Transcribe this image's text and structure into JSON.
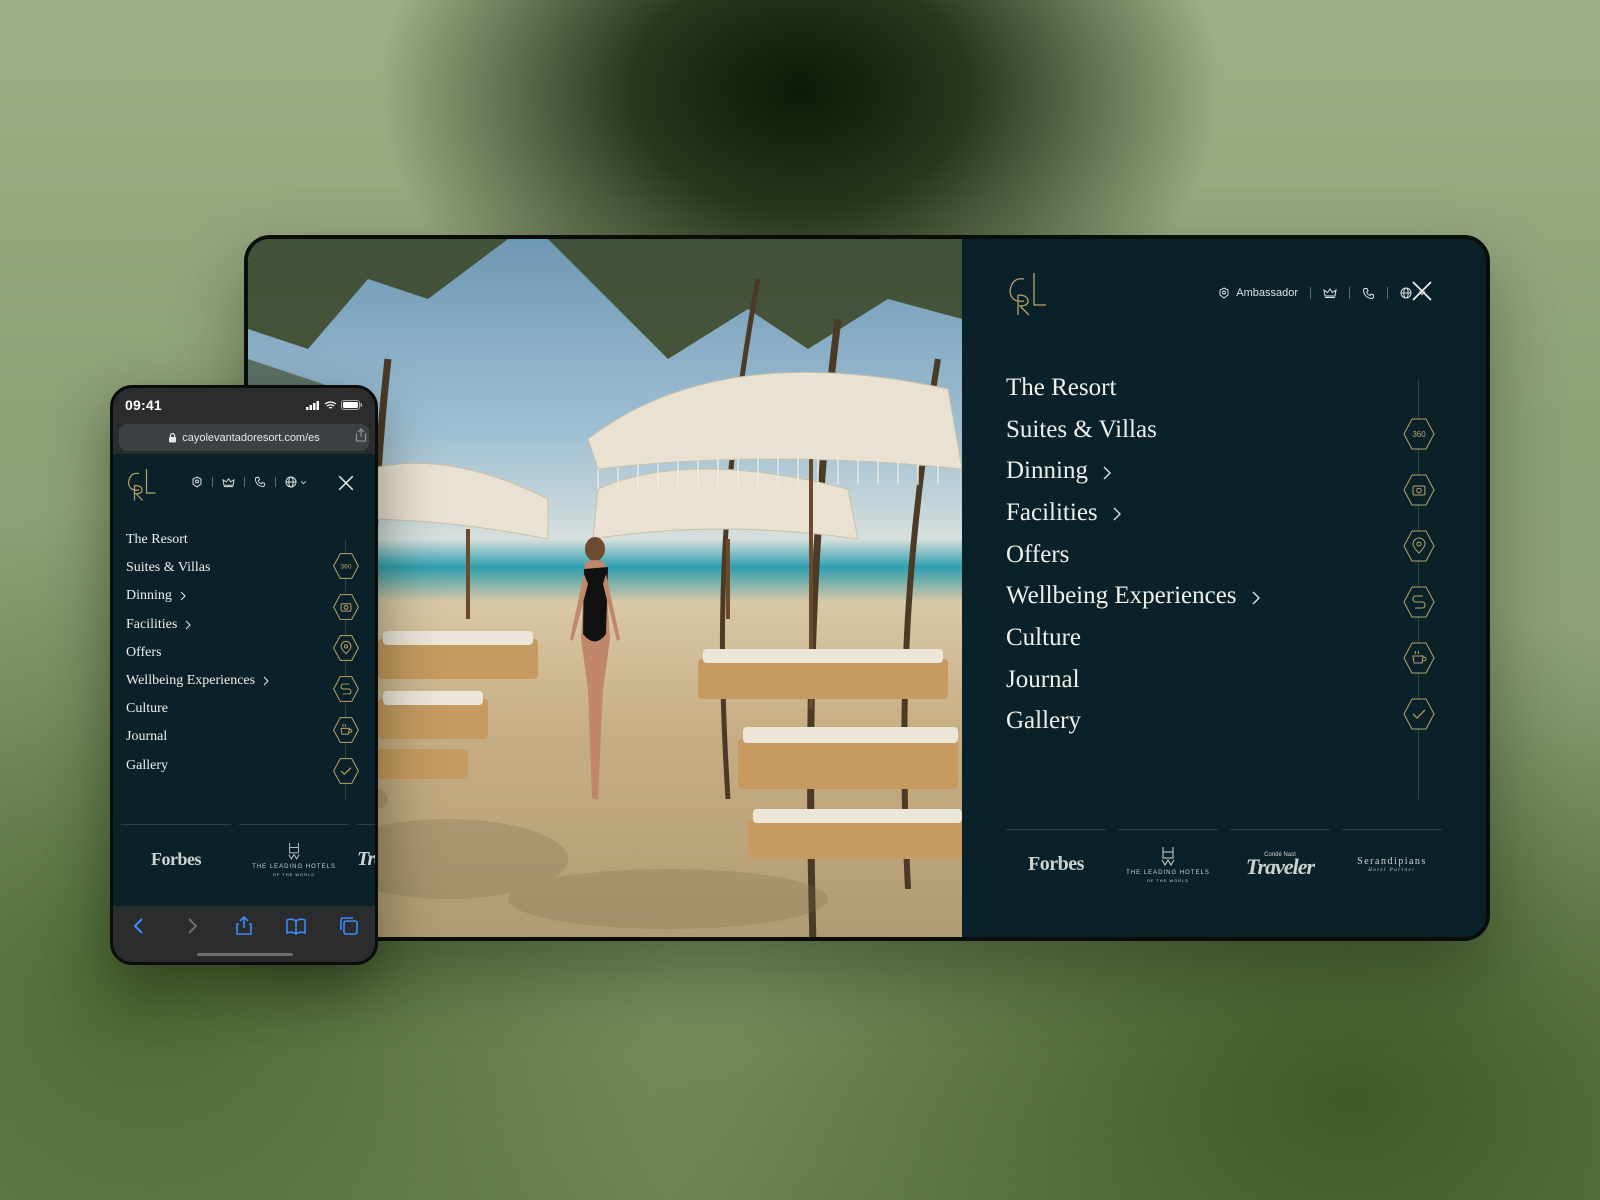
{
  "desktop": {
    "utility": {
      "ambassador_label": "Ambassador"
    },
    "menu": [
      {
        "label": "The Resort",
        "has_submenu": false
      },
      {
        "label": "Suites & Villas",
        "has_submenu": false
      },
      {
        "label": "Dinning",
        "has_submenu": true
      },
      {
        "label": "Facilities",
        "has_submenu": true
      },
      {
        "label": "Offers",
        "has_submenu": false
      },
      {
        "label": "Wellbeing Experiences",
        "has_submenu": true
      },
      {
        "label": "Culture",
        "has_submenu": false
      },
      {
        "label": "Journal",
        "has_submenu": false
      },
      {
        "label": "Gallery",
        "has_submenu": false
      }
    ],
    "side_icons": [
      "360-view-icon",
      "camera-icon",
      "map-pin-icon",
      "route-icon",
      "coffee-cup-icon",
      "checkmark-icon"
    ],
    "side_icon_label_360": "360",
    "partner_logos": {
      "forbes": "Forbes",
      "lhw_line1": "THE LEADING HOTELS",
      "lhw_line2": "OF THE WORLD",
      "traveler_small": "Condé Nast",
      "traveler": "Traveler",
      "serandipians": "Serandipians",
      "serandipians_sub": "Hotel Partner"
    }
  },
  "phone": {
    "status_time": "09:41",
    "url": "cayolevantadoresort.com/es",
    "menu": [
      {
        "label": "The Resort",
        "has_submenu": false
      },
      {
        "label": "Suites & Villas",
        "has_submenu": false
      },
      {
        "label": "Dinning",
        "has_submenu": true
      },
      {
        "label": "Facilities",
        "has_submenu": true
      },
      {
        "label": "Offers",
        "has_submenu": false
      },
      {
        "label": "Wellbeing Experiences",
        "has_submenu": true
      },
      {
        "label": "Culture",
        "has_submenu": false
      },
      {
        "label": "Journal",
        "has_submenu": false
      },
      {
        "label": "Gallery",
        "has_submenu": false
      }
    ],
    "partner_logos": {
      "forbes": "Forbes",
      "lhw_line1": "THE LEADING HOTELS",
      "lhw_line2": "OF THE WORLD",
      "traveler_partial": "Tra"
    }
  },
  "colors": {
    "panel": "#0b2129",
    "gold": "#b8a36a",
    "menu_text": "#eef0ea",
    "safari_bar": "#2a2c2e",
    "safari_accent": "#3d8af7"
  }
}
